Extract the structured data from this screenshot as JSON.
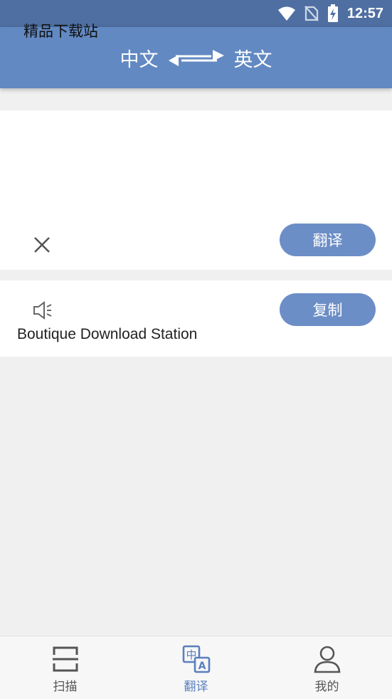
{
  "status_bar": {
    "time": "12:57",
    "icons": [
      "wifi-icon",
      "no-sim-icon",
      "battery-charging-icon"
    ]
  },
  "header": {
    "source_lang": "中文",
    "target_lang": "英文",
    "swap_icon": "swap-arrows-icon",
    "color": "#6289c2"
  },
  "input": {
    "text": "精品下载站",
    "clear_icon": "close-icon",
    "translate_button": "翻译"
  },
  "output": {
    "speaker_icon": "speaker-icon",
    "text": "Boutique Download Station",
    "copy_button": "复制"
  },
  "tabs": [
    {
      "label": "扫描",
      "icon": "scan-icon",
      "active": false
    },
    {
      "label": "翻译",
      "icon": "translate-icon",
      "active": true
    },
    {
      "label": "我的",
      "icon": "user-icon",
      "active": false
    }
  ],
  "colors": {
    "accent": "#6c8ec7",
    "active_tab": "#5b7fbf"
  }
}
